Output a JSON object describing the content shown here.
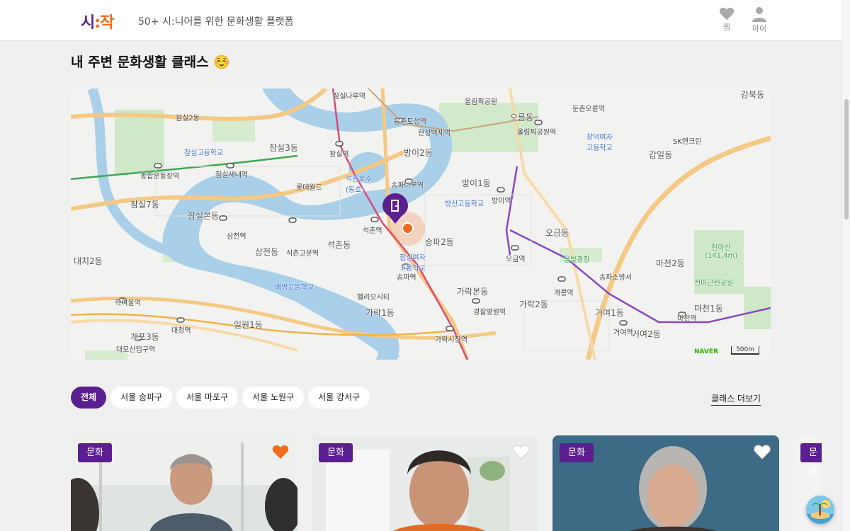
{
  "header": {
    "logo_left": "시",
    "logo_sep": ":",
    "logo_right": "작",
    "tagline": "50+ 시:니어를 위한 문화생활 플랫폼",
    "like_label": "찜",
    "my_label": "마이"
  },
  "section": {
    "title": "내 주변 문화생활 클래스 ☺️"
  },
  "map": {
    "labels": {
      "jamsil2": "잠실2동",
      "jamsil3": "잠실3동",
      "jamsilbon": "잠실본동",
      "jamsil7": "잠실7동",
      "seokchon": "석촌동",
      "samjeon": "삼전동",
      "songpa2": "송파2동",
      "bangi1": "방이1동",
      "bangi2": "방이2동",
      "ogeum": "오금동",
      "garak1": "가락1동",
      "garak2": "가락2동",
      "garakbon": "가락본동",
      "geoyeo1": "거여1동",
      "geoyeo2": "거여2동",
      "macheon1": "마천1동",
      "macheon2": "마천2동",
      "ilwon1": "일원1동",
      "gaepo3": "개포3동",
      "daechi2": "대치2동",
      "gamil": "감일동",
      "gamboek": "감북동",
      "ogeumdong_top": "오륜동",
      "dunchon": "둔촌오륜역",
      "st_jamsil": "잠실역",
      "st_seokchon": "석촌역",
      "st_songpa": "송파역",
      "st_songpanaru": "송파나루역",
      "st_bangi": "방이역",
      "st_ogeum": "오금역",
      "st_garaksijang": "가락시장역",
      "st_kyungchal": "경찰병원역",
      "st_gaerong": "개롱역",
      "st_geoyeo": "거여역",
      "st_macheon": "마천역",
      "st_samjeon": "삼전역",
      "st_seokchongobun": "석촌고분역",
      "st_sports": "종합운동장역",
      "st_jamsilsaenae": "잠실새내역",
      "st_mongchon": "몽촌토성역",
      "st_olympic": "올림픽공원역",
      "st_hangnyeoul": "학여울역",
      "st_daecheong": "대청역",
      "st_daemosan": "대모산입구역",
      "st_jamsilnaru": "잠실나루역",
      "lotte": "롯데월드",
      "seokchonlake": "석촌호수\n(동호)",
      "olympicpark": "올림픽공원",
      "cheonmasan": "천마산\n(141.4m)",
      "cheonmapark": "천마근린공원",
      "mulbit": "물빛광장",
      "helio": "헬리오시티",
      "songpa_gu": "송파소방서",
      "sk": "SK엔크린",
      "hanyang": "한성백제역",
      "jamsilhigh": "잠실고등학교",
      "bangsan": "방산고등학교",
      "changdeok": "창덕여자\n고등학교",
      "baemyeong": "배명고등학교",
      "jamsilgirls": "잠실여자\n고등학교",
      "naver": "NAVER",
      "scale": "500m"
    }
  },
  "filters": {
    "chips": [
      "전체",
      "서울 송파구",
      "서울 마포구",
      "서울 노원구",
      "서울 강서구"
    ],
    "more": "클래스 더보기"
  },
  "cards": [
    {
      "badge": "문화",
      "liked": true
    },
    {
      "badge": "문화",
      "liked": false
    },
    {
      "badge": "문화",
      "liked": false
    },
    {
      "badge": "문화",
      "liked": false
    }
  ],
  "colors": {
    "brand_purple": "#5b1f8f",
    "brand_orange": "#f26a1b"
  }
}
